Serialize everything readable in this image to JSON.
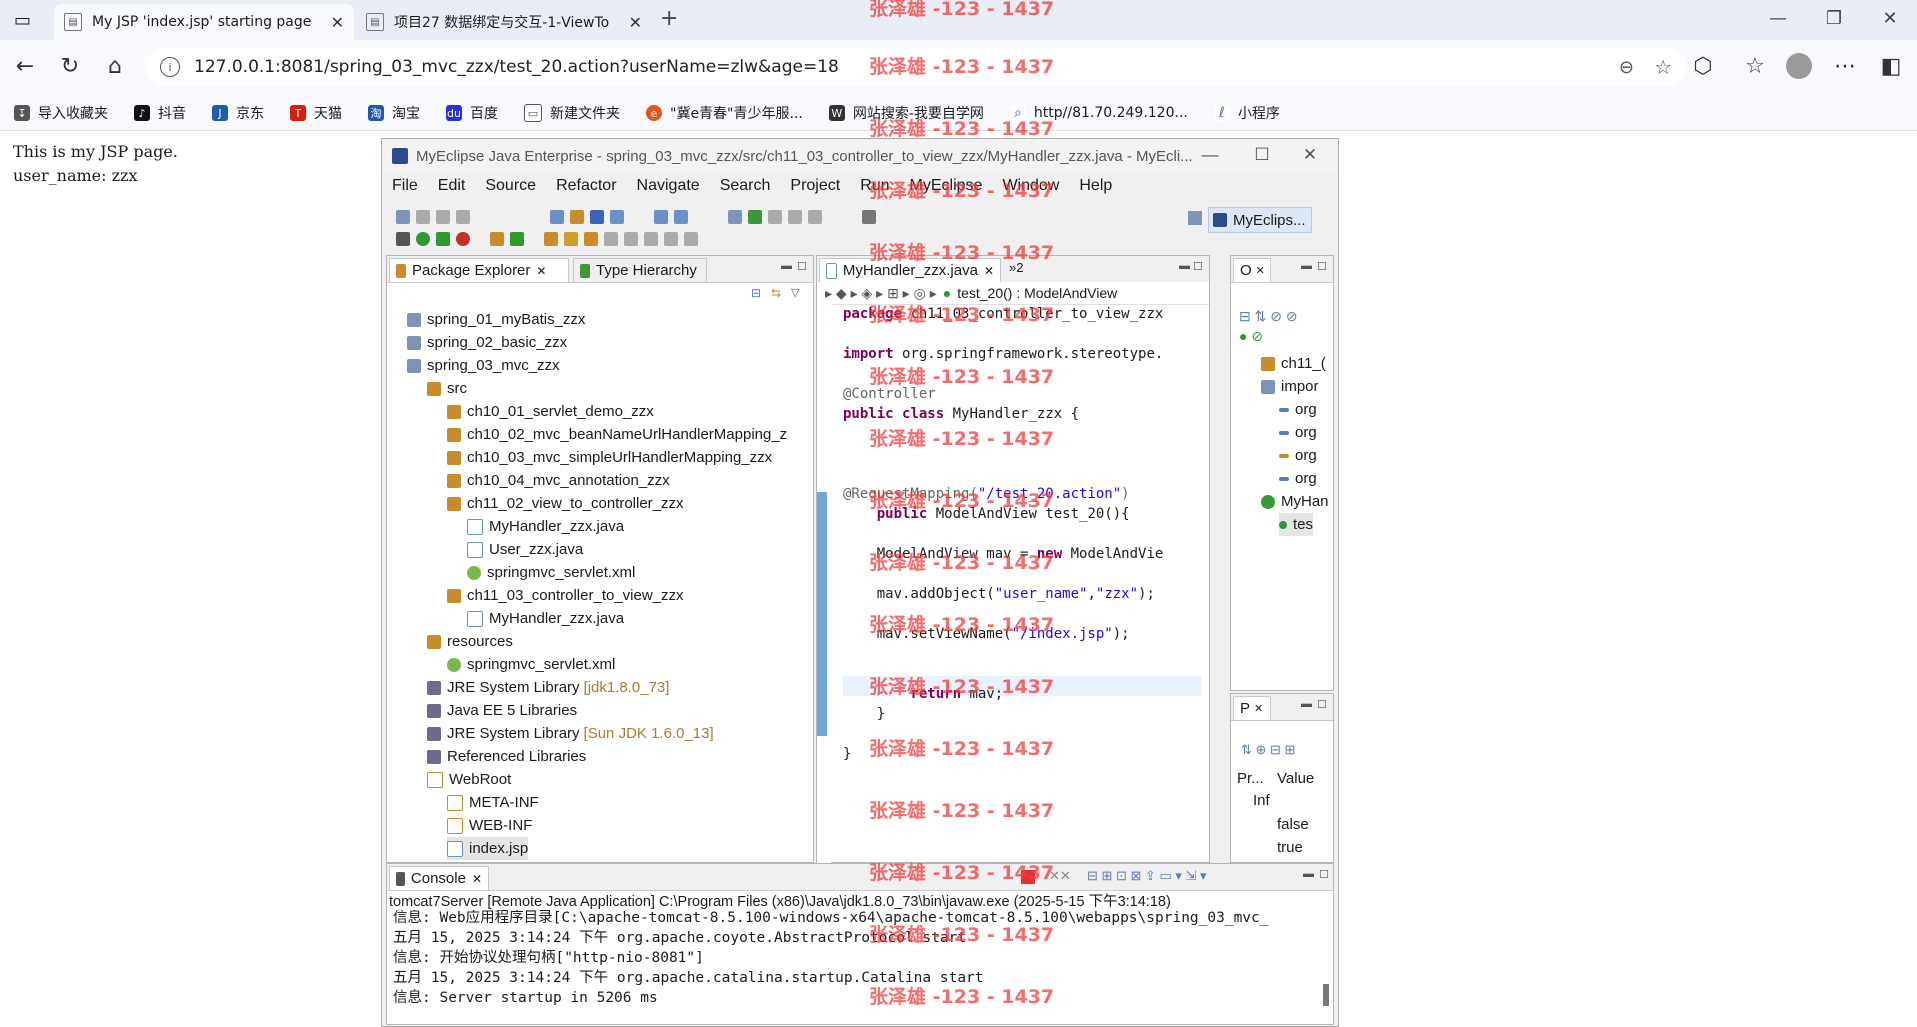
{
  "browser": {
    "tabs": [
      {
        "title": "My JSP 'index.jsp' starting page",
        "active": true
      },
      {
        "title": "项目27 数据绑定与交互-1-ViewTo",
        "active": false
      }
    ],
    "new_tab_icon": "plus-icon",
    "address": "127.0.0.1:8081/spring_03_mvc_zzx/test_20.action?userName=zlw&age=18",
    "bookmarks": [
      {
        "label": "导入收藏夹",
        "icon": "import-icon",
        "color": "#555555"
      },
      {
        "label": "抖音",
        "icon": "tiktok-icon",
        "color": "#111111"
      },
      {
        "label": "京东",
        "icon": "jd-icon",
        "color": "#1e5ea8"
      },
      {
        "label": "天猫",
        "icon": "tmall-icon",
        "color": "#d81e06"
      },
      {
        "label": "淘宝",
        "icon": "taobao-icon",
        "color": "#1e5ea8"
      },
      {
        "label": "百度",
        "icon": "baidu-icon",
        "color": "#2932e1"
      },
      {
        "label": "新建文件夹",
        "icon": "folder-icon",
        "color": "#555555"
      },
      {
        "label": "\"冀e青春\"青少年服...",
        "icon": "youth-icon",
        "color": "#e2541b"
      },
      {
        "label": "网站搜索-我要自学网",
        "icon": "site-icon",
        "color": "#333333"
      },
      {
        "label": "http//81.70.249.120...",
        "icon": "search-icon",
        "color": "#2864c8"
      },
      {
        "label": "小程序",
        "icon": "miniapp-icon",
        "color": "#5b6fd6"
      }
    ]
  },
  "page": {
    "line1": "This is my JSP page.",
    "line2": "user_name: zzx"
  },
  "eclipse": {
    "title": "MyEclipse Java Enterprise - spring_03_mvc_zzx/src/ch11_03_controller_to_view_zzx/MyHandler_zzx.java - MyEcli...",
    "menu": [
      "File",
      "Edit",
      "Source",
      "Refactor",
      "Navigate",
      "Search",
      "Project",
      "Run",
      "MyEclipse",
      "Window",
      "Help"
    ],
    "perspective": "MyEclips...",
    "package_explorer": {
      "tab": "Package Explorer",
      "tab2": "Type Hierarchy",
      "items": [
        {
          "label": "spring_01_myBatis_zzx",
          "deco": ""
        },
        {
          "label": "spring_02_basic_zzx",
          "deco": ""
        },
        {
          "label": "spring_03_mvc_zzx",
          "deco": ""
        },
        {
          "label": "src",
          "deco": ""
        },
        {
          "label": "ch10_01_servlet_demo_zzx",
          "deco": ""
        },
        {
          "label": "ch10_02_mvc_beanNameUrlHandlerMapping_z",
          "deco": ""
        },
        {
          "label": "ch10_03_mvc_simpleUrlHandlerMapping_zzx",
          "deco": ""
        },
        {
          "label": "ch10_04_mvc_annotation_zzx",
          "deco": ""
        },
        {
          "label": "ch11_02_view_to_controller_zzx",
          "deco": ""
        },
        {
          "label": "MyHandler_zzx.java",
          "deco": ""
        },
        {
          "label": "User_zzx.java",
          "deco": ""
        },
        {
          "label": "springmvc_servlet.xml",
          "deco": ""
        },
        {
          "label": "ch11_03_controller_to_view_zzx",
          "deco": ""
        },
        {
          "label": "MyHandler_zzx.java",
          "deco": ""
        },
        {
          "label": "resources",
          "deco": ""
        },
        {
          "label": "springmvc_servlet.xml",
          "deco": ""
        },
        {
          "label": "JRE System Library",
          "deco": "[jdk1.8.0_73]"
        },
        {
          "label": "Java EE 5 Libraries",
          "deco": ""
        },
        {
          "label": "JRE System Library",
          "deco": "[Sun JDK 1.6.0_13]"
        },
        {
          "label": "Referenced Libraries",
          "deco": ""
        },
        {
          "label": "WebRoot",
          "deco": ""
        },
        {
          "label": "META-INF",
          "deco": ""
        },
        {
          "label": "WEB-INF",
          "deco": ""
        },
        {
          "label": "index.jsp",
          "deco": ""
        }
      ]
    },
    "editor": {
      "tab": "MyHandler_zzx.java",
      "more_tabs": "»2",
      "breadcrumb_method": "test_20() : ModelAndView",
      "code": {
        "pkg_kw": "package",
        "pkg": " ch11_03_controller_to_view_zzx",
        "import_kw": "import",
        "import": " org.springframework.stereotype.",
        "controller": "@Controller",
        "public_kw": "public",
        "class_kw": "class",
        "class_name": " MyHandler_zzx {",
        "req_ann": "@RequestMapping(",
        "req_str": "\"/test_20.action\"",
        "req_end": ")",
        "method_sig": " ModelAndView test_20(){",
        "mav_decl": "ModelAndView mav = ",
        "new_kw": "new",
        "mav_ctor": " ModelAndVie",
        "add_obj1": "mav.addObject(",
        "add_str1": "\"user_name\"",
        "add_comma": ",",
        "add_str2": "\"zzx\"",
        "add_end": ");",
        "set_view1": "mav.setViewName(",
        "set_view_str": "\"/index.jsp\"",
        "set_view_end": ");",
        "return_kw": "return",
        "return_rest": " mav;",
        "close1": "}",
        "close2": "}"
      }
    },
    "outline": {
      "tab": "O",
      "items": [
        "ch11_(",
        "impor",
        "org",
        "org",
        "org",
        "org",
        "MyHan",
        "tes"
      ]
    },
    "properties": {
      "tab": "P",
      "col1": "Pr...",
      "col2": "Value",
      "row1": "Inf",
      "val1": "false",
      "val2": "true"
    },
    "console": {
      "tab": "Console",
      "header": "tomcat7Server [Remote Java Application] C:\\Program Files (x86)\\Java\\jdk1.8.0_73\\bin\\javaw.exe (2025-5-15 下午3:14:18)",
      "lines": [
        "信息: Web应用程序目录[C:\\apache-tomcat-8.5.100-windows-x64\\apache-tomcat-8.5.100\\webapps\\spring_03_mvc_",
        "五月 15, 2025 3:14:24 下午 org.apache.coyote.AbstractProtocol start",
        "信息: 开始协议处理句柄[\"http-nio-8081\"]",
        "五月 15, 2025 3:14:24 下午 org.apache.catalina.startup.Catalina start",
        "信息: Server startup in 5206 ms"
      ]
    }
  },
  "watermark": "张泽雄 -123 - 1437"
}
